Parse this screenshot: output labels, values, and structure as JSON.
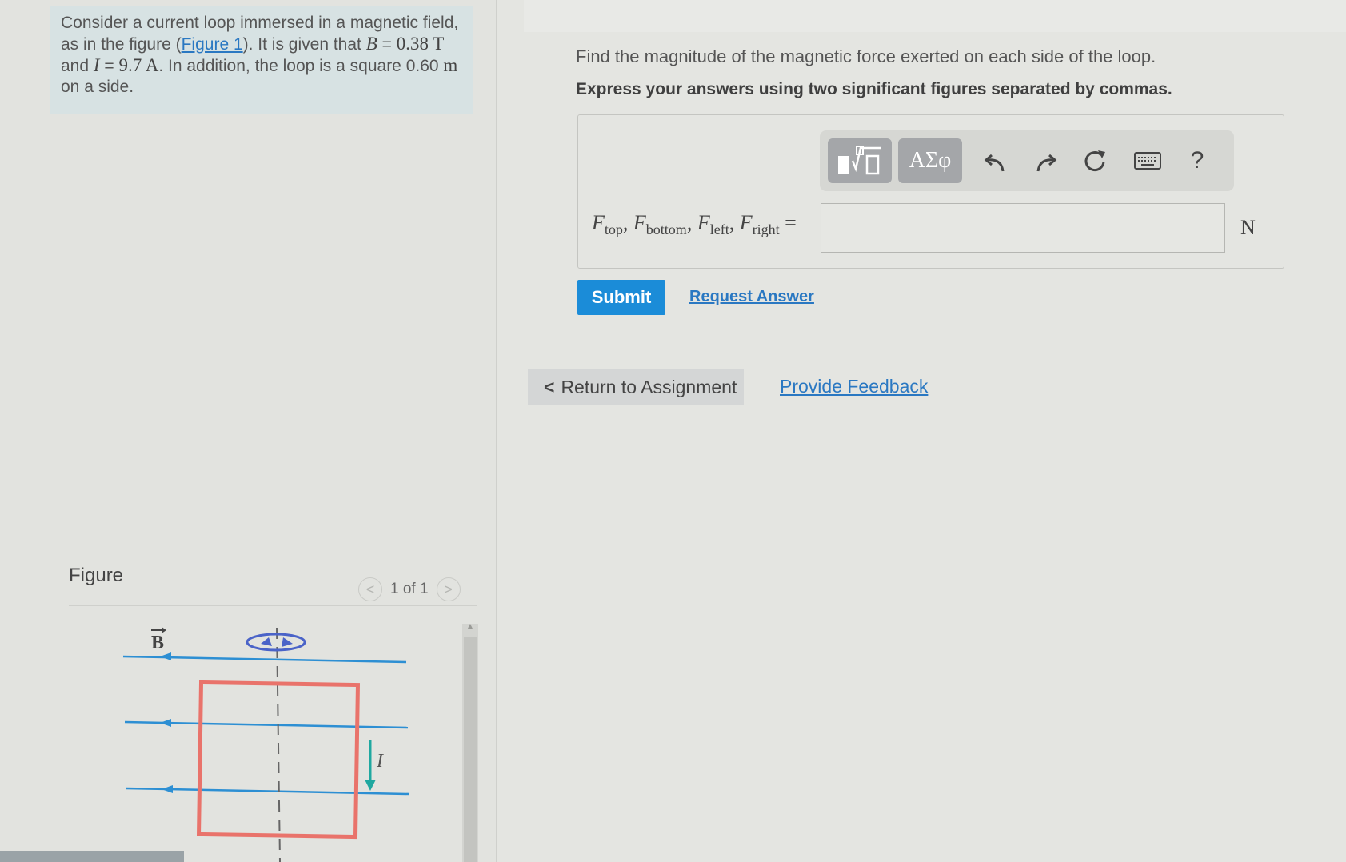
{
  "problem": {
    "p1": "Consider a current loop immersed in a magnetic field, as in the figure (",
    "figure_link": "Figure 1",
    "p2": "). It is given that ",
    "B_sym": "B",
    "eq": " = ",
    "B_val": "0.38 T",
    "and": " and ",
    "I_sym": "I",
    "I_val": "9.7 A",
    "p3": ". In addition, the loop is a square 0.60 ",
    "m_unit": "m",
    "p4": " on a side."
  },
  "figure": {
    "title": "Figure",
    "pager": "1 of 1",
    "prev": "<",
    "next": ">",
    "b_label": "B",
    "i_label": "I"
  },
  "question": {
    "prompt": "Find the magnitude of the magnetic force exerted on each side of the loop.",
    "instruction": "Express your answers using two significant figures separated by commas.",
    "F": "F",
    "sub_top": "top",
    "sub_bottom": "bottom",
    "sub_left": "left",
    "sub_right": "right",
    "comma": ", ",
    "equals": " =",
    "unit": "N",
    "input_value": ""
  },
  "toolbar": {
    "templates_icon": "template-icon",
    "greek_label": "ΑΣφ",
    "undo_icon": "undo-icon",
    "redo_icon": "redo-icon",
    "reset_icon": "reset-icon",
    "keyboard_icon": "keyboard-icon",
    "help_label": "?"
  },
  "actions": {
    "submit": "Submit",
    "request": "Request Answer",
    "return_arrow": "<",
    "return": "Return to Assignment",
    "feedback": "Provide Feedback"
  },
  "colors": {
    "submit_bg": "#1b8cd8",
    "link": "#2a78c2",
    "loop": "#e9736b",
    "field_line": "#2d8fd3",
    "current_arrow": "#1fa8a0"
  }
}
